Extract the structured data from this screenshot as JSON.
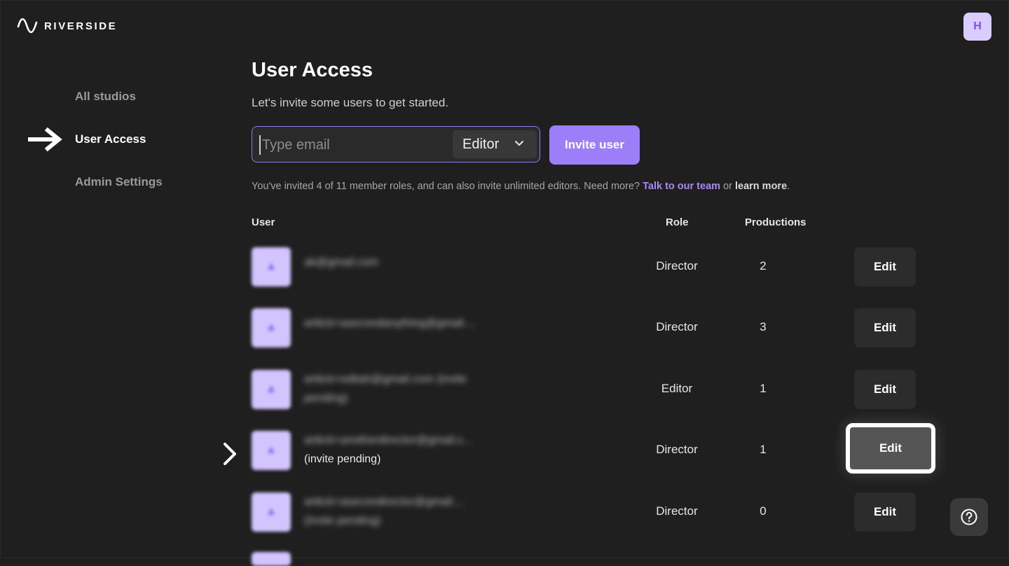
{
  "app": {
    "brand": "RIVERSIDE",
    "user_initial": "H"
  },
  "sidebar": {
    "items": [
      {
        "label": "All studios",
        "active": false
      },
      {
        "label": "User Access",
        "active": true
      },
      {
        "label": "Admin Settings",
        "active": false
      }
    ]
  },
  "main": {
    "title": "User Access",
    "subtitle": "Let's invite some users to get started.",
    "invite": {
      "placeholder": "Type email",
      "role_value": "Editor",
      "button_label": "Invite user"
    },
    "info": {
      "text": "You've invited 4 of 11 member roles, and can also invite unlimited editors. Need more?",
      "link_team": "Talk to our team",
      "or": "or",
      "link_learn": "learn more",
      "period": "."
    },
    "columns": {
      "user": "User",
      "role": "Role",
      "productions": "Productions"
    },
    "rows": [
      {
        "email": "ak@gmail.com",
        "pending": "",
        "role": "Director",
        "productions": "2",
        "edit": "Edit"
      },
      {
        "email": "arttick+asecondanything@gmail....",
        "pending": "",
        "role": "Director",
        "productions": "3",
        "edit": "Edit"
      },
      {
        "email": "arttick+editah@gmail.com (invite",
        "pending": "pending)",
        "role": "Editor",
        "productions": "1",
        "edit": "Edit"
      },
      {
        "email": "arttick+anotherdirector@gmail.c...",
        "pending": "(invite pending)",
        "role": "Director",
        "productions": "1",
        "edit": "Edit"
      },
      {
        "email": "arttick+asecondirector@gmail....",
        "pending": "(invite pending)",
        "role": "Director",
        "productions": "0",
        "edit": "Edit"
      }
    ]
  },
  "colors": {
    "background": "#1f1f1f",
    "accent": "#9b7ef8",
    "avatar": "#d9ccff"
  },
  "icons": [
    "riverside-wave-icon",
    "arrow-right-icon",
    "chevron-down-icon",
    "chevron-right-icon",
    "help-icon"
  ]
}
